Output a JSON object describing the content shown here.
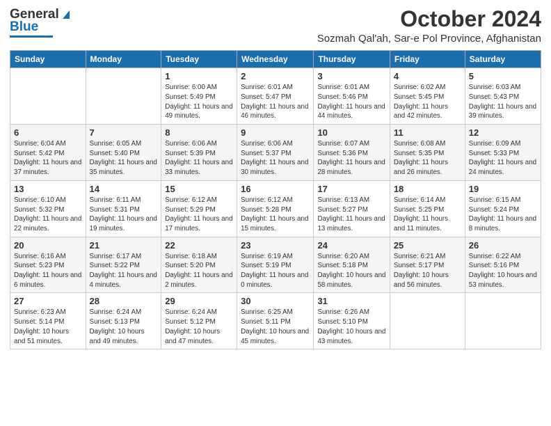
{
  "logo": {
    "general": "General",
    "blue": "Blue"
  },
  "title": "October 2024",
  "subtitle": "Sozmah Qal'ah, Sar-e Pol Province, Afghanistan",
  "weekdays": [
    "Sunday",
    "Monday",
    "Tuesday",
    "Wednesday",
    "Thursday",
    "Friday",
    "Saturday"
  ],
  "weeks": [
    [
      {
        "day": "",
        "sunrise": "",
        "sunset": "",
        "daylight": ""
      },
      {
        "day": "",
        "sunrise": "",
        "sunset": "",
        "daylight": ""
      },
      {
        "day": "1",
        "sunrise": "Sunrise: 6:00 AM",
        "sunset": "Sunset: 5:49 PM",
        "daylight": "Daylight: 11 hours and 49 minutes."
      },
      {
        "day": "2",
        "sunrise": "Sunrise: 6:01 AM",
        "sunset": "Sunset: 5:47 PM",
        "daylight": "Daylight: 11 hours and 46 minutes."
      },
      {
        "day": "3",
        "sunrise": "Sunrise: 6:01 AM",
        "sunset": "Sunset: 5:46 PM",
        "daylight": "Daylight: 11 hours and 44 minutes."
      },
      {
        "day": "4",
        "sunrise": "Sunrise: 6:02 AM",
        "sunset": "Sunset: 5:45 PM",
        "daylight": "Daylight: 11 hours and 42 minutes."
      },
      {
        "day": "5",
        "sunrise": "Sunrise: 6:03 AM",
        "sunset": "Sunset: 5:43 PM",
        "daylight": "Daylight: 11 hours and 39 minutes."
      }
    ],
    [
      {
        "day": "6",
        "sunrise": "Sunrise: 6:04 AM",
        "sunset": "Sunset: 5:42 PM",
        "daylight": "Daylight: 11 hours and 37 minutes."
      },
      {
        "day": "7",
        "sunrise": "Sunrise: 6:05 AM",
        "sunset": "Sunset: 5:40 PM",
        "daylight": "Daylight: 11 hours and 35 minutes."
      },
      {
        "day": "8",
        "sunrise": "Sunrise: 6:06 AM",
        "sunset": "Sunset: 5:39 PM",
        "daylight": "Daylight: 11 hours and 33 minutes."
      },
      {
        "day": "9",
        "sunrise": "Sunrise: 6:06 AM",
        "sunset": "Sunset: 5:37 PM",
        "daylight": "Daylight: 11 hours and 30 minutes."
      },
      {
        "day": "10",
        "sunrise": "Sunrise: 6:07 AM",
        "sunset": "Sunset: 5:36 PM",
        "daylight": "Daylight: 11 hours and 28 minutes."
      },
      {
        "day": "11",
        "sunrise": "Sunrise: 6:08 AM",
        "sunset": "Sunset: 5:35 PM",
        "daylight": "Daylight: 11 hours and 26 minutes."
      },
      {
        "day": "12",
        "sunrise": "Sunrise: 6:09 AM",
        "sunset": "Sunset: 5:33 PM",
        "daylight": "Daylight: 11 hours and 24 minutes."
      }
    ],
    [
      {
        "day": "13",
        "sunrise": "Sunrise: 6:10 AM",
        "sunset": "Sunset: 5:32 PM",
        "daylight": "Daylight: 11 hours and 22 minutes."
      },
      {
        "day": "14",
        "sunrise": "Sunrise: 6:11 AM",
        "sunset": "Sunset: 5:31 PM",
        "daylight": "Daylight: 11 hours and 19 minutes."
      },
      {
        "day": "15",
        "sunrise": "Sunrise: 6:12 AM",
        "sunset": "Sunset: 5:29 PM",
        "daylight": "Daylight: 11 hours and 17 minutes."
      },
      {
        "day": "16",
        "sunrise": "Sunrise: 6:12 AM",
        "sunset": "Sunset: 5:28 PM",
        "daylight": "Daylight: 11 hours and 15 minutes."
      },
      {
        "day": "17",
        "sunrise": "Sunrise: 6:13 AM",
        "sunset": "Sunset: 5:27 PM",
        "daylight": "Daylight: 11 hours and 13 minutes."
      },
      {
        "day": "18",
        "sunrise": "Sunrise: 6:14 AM",
        "sunset": "Sunset: 5:25 PM",
        "daylight": "Daylight: 11 hours and 11 minutes."
      },
      {
        "day": "19",
        "sunrise": "Sunrise: 6:15 AM",
        "sunset": "Sunset: 5:24 PM",
        "daylight": "Daylight: 11 hours and 8 minutes."
      }
    ],
    [
      {
        "day": "20",
        "sunrise": "Sunrise: 6:16 AM",
        "sunset": "Sunset: 5:23 PM",
        "daylight": "Daylight: 11 hours and 6 minutes."
      },
      {
        "day": "21",
        "sunrise": "Sunrise: 6:17 AM",
        "sunset": "Sunset: 5:22 PM",
        "daylight": "Daylight: 11 hours and 4 minutes."
      },
      {
        "day": "22",
        "sunrise": "Sunrise: 6:18 AM",
        "sunset": "Sunset: 5:20 PM",
        "daylight": "Daylight: 11 hours and 2 minutes."
      },
      {
        "day": "23",
        "sunrise": "Sunrise: 6:19 AM",
        "sunset": "Sunset: 5:19 PM",
        "daylight": "Daylight: 11 hours and 0 minutes."
      },
      {
        "day": "24",
        "sunrise": "Sunrise: 6:20 AM",
        "sunset": "Sunset: 5:18 PM",
        "daylight": "Daylight: 10 hours and 58 minutes."
      },
      {
        "day": "25",
        "sunrise": "Sunrise: 6:21 AM",
        "sunset": "Sunset: 5:17 PM",
        "daylight": "Daylight: 10 hours and 56 minutes."
      },
      {
        "day": "26",
        "sunrise": "Sunrise: 6:22 AM",
        "sunset": "Sunset: 5:16 PM",
        "daylight": "Daylight: 10 hours and 53 minutes."
      }
    ],
    [
      {
        "day": "27",
        "sunrise": "Sunrise: 6:23 AM",
        "sunset": "Sunset: 5:14 PM",
        "daylight": "Daylight: 10 hours and 51 minutes."
      },
      {
        "day": "28",
        "sunrise": "Sunrise: 6:24 AM",
        "sunset": "Sunset: 5:13 PM",
        "daylight": "Daylight: 10 hours and 49 minutes."
      },
      {
        "day": "29",
        "sunrise": "Sunrise: 6:24 AM",
        "sunset": "Sunset: 5:12 PM",
        "daylight": "Daylight: 10 hours and 47 minutes."
      },
      {
        "day": "30",
        "sunrise": "Sunrise: 6:25 AM",
        "sunset": "Sunset: 5:11 PM",
        "daylight": "Daylight: 10 hours and 45 minutes."
      },
      {
        "day": "31",
        "sunrise": "Sunrise: 6:26 AM",
        "sunset": "Sunset: 5:10 PM",
        "daylight": "Daylight: 10 hours and 43 minutes."
      },
      {
        "day": "",
        "sunrise": "",
        "sunset": "",
        "daylight": ""
      },
      {
        "day": "",
        "sunrise": "",
        "sunset": "",
        "daylight": ""
      }
    ]
  ]
}
